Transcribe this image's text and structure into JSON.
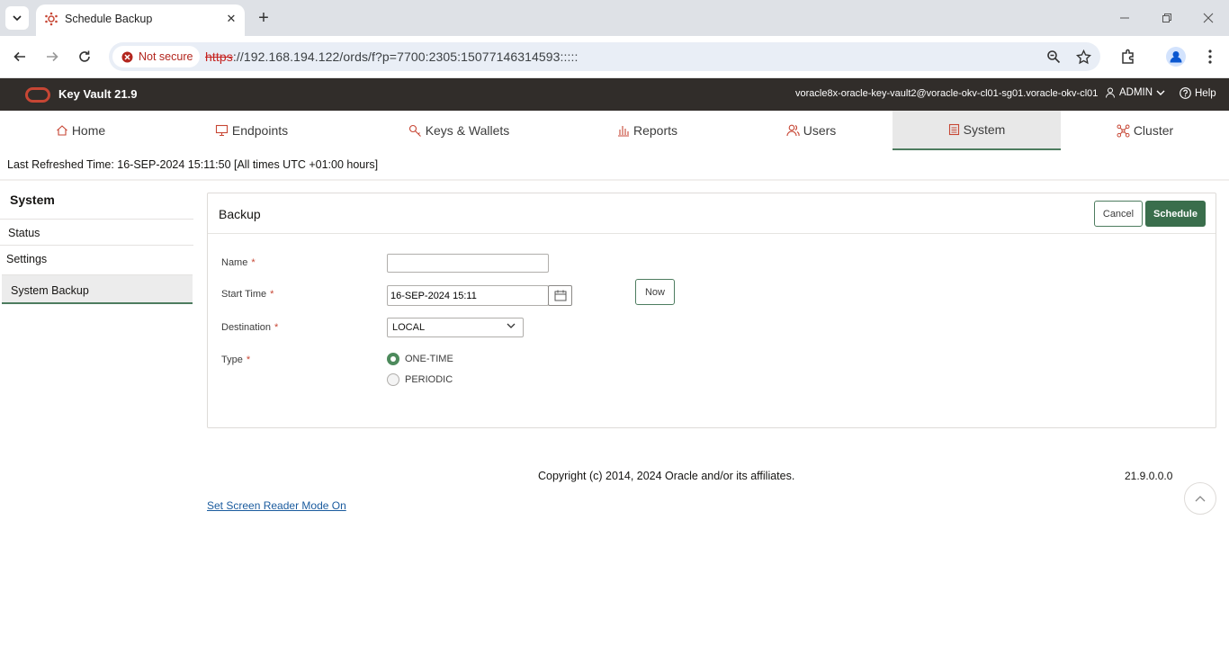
{
  "browser": {
    "tab_title": "Schedule Backup",
    "security_label": "Not secure",
    "url_scheme": "https",
    "url_rest": "://192.168.194.122/ords/f?p=7700:2305:15077146314593:::::"
  },
  "header": {
    "app_name": "Key Vault 21.9",
    "account": "voracle8x-oracle-key-vault2@voracle-okv-cl01-sg01.voracle-okv-cl01",
    "user": "ADMIN",
    "help": "Help",
    "brand_color": "#c74634"
  },
  "nav": {
    "tabs": [
      {
        "label": "Home",
        "icon": "home-icon"
      },
      {
        "label": "Endpoints",
        "icon": "monitor-icon"
      },
      {
        "label": "Keys & Wallets",
        "icon": "key-icon"
      },
      {
        "label": "Reports",
        "icon": "bar-chart-icon"
      },
      {
        "label": "Users",
        "icon": "users-icon"
      },
      {
        "label": "System",
        "icon": "list-icon",
        "active": true
      },
      {
        "label": "Cluster",
        "icon": "cluster-icon"
      }
    ]
  },
  "refresh_text": "Last Refreshed Time: 16-SEP-2024 15:11:50 [All times UTC +01:00 hours]",
  "side": {
    "title": "System",
    "items": [
      "Status",
      "Settings",
      "System Backup"
    ]
  },
  "panel": {
    "title": "Backup",
    "cancel_label": "Cancel",
    "schedule_label": "Schedule",
    "fields": {
      "name_label": "Name",
      "name_value": "",
      "start_label": "Start Time",
      "start_value": "16-SEP-2024 15:11",
      "now_label": "Now",
      "destination_label": "Destination",
      "destination_value": "LOCAL",
      "type_label": "Type",
      "type_options": [
        "ONE-TIME",
        "PERIODIC"
      ],
      "type_selected": "ONE-TIME",
      "required_mark": "*"
    }
  },
  "footer": {
    "copyright": "Copyright (c) 2014, 2024 Oracle and/or its affiliates.",
    "version": "21.9.0.0.0",
    "screen_reader_link": "Set Screen Reader Mode On"
  }
}
